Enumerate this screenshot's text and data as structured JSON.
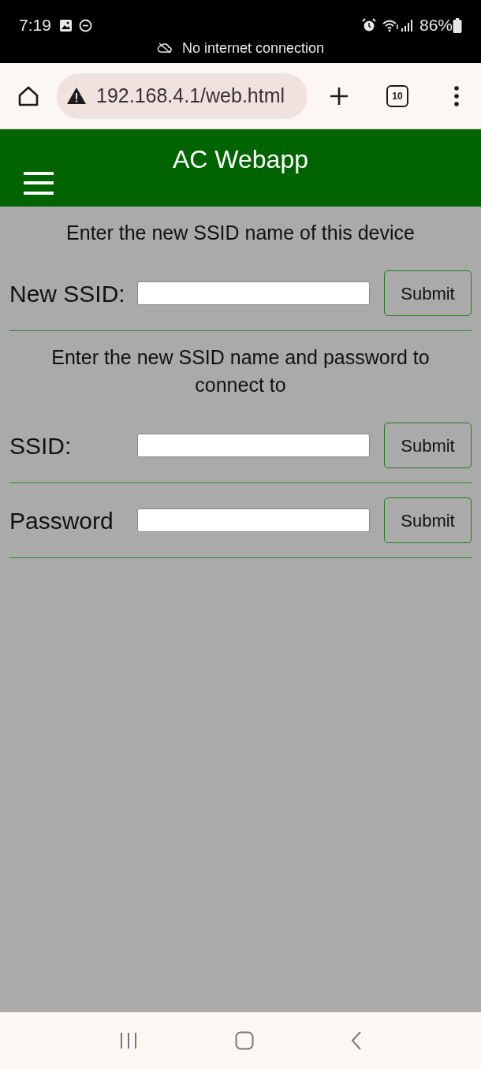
{
  "status_bar": {
    "time": "7:19",
    "battery": "86%",
    "notice": "No internet connection"
  },
  "browser": {
    "url": "192.168.4.1/web.html",
    "tab_count": "10"
  },
  "header": {
    "title": "AC Webapp"
  },
  "form": [
    {
      "kind": "heading",
      "text": "Enter the new SSID name of this device"
    },
    {
      "kind": "field",
      "label": "New SSID:",
      "button": "Submit"
    },
    {
      "kind": "heading",
      "text": "Enter the new SSID name and password to connect to"
    },
    {
      "kind": "field",
      "label": "SSID:",
      "button": "Submit"
    },
    {
      "kind": "field",
      "label": "Password",
      "button": "Submit"
    }
  ]
}
